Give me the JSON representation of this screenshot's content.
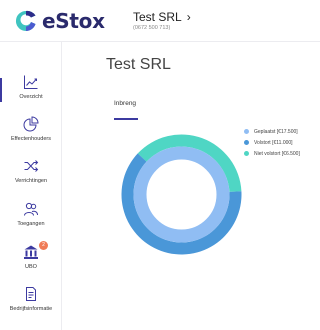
{
  "header": {
    "brand": "eStox",
    "company_name": "Test SRL",
    "company_id": "(0672 500 713)",
    "chevron": "›"
  },
  "sidebar": {
    "items": [
      {
        "label": "Overzicht",
        "icon": "line-chart-icon",
        "active": true
      },
      {
        "label": "Effectenhouders",
        "icon": "pie-chart-icon"
      },
      {
        "label": "Verrichtingen",
        "icon": "shuffle-icon"
      },
      {
        "label": "Toegangen",
        "icon": "users-icon"
      },
      {
        "label": "UBO",
        "icon": "bank-icon",
        "badge": "2"
      },
      {
        "label": "Bedrijfsinformatie",
        "icon": "document-icon"
      }
    ]
  },
  "main": {
    "title": "Test SRL",
    "card_title": "Inbreng"
  },
  "chart_data": {
    "type": "pie",
    "categories": [
      "Geplaatst",
      "Volstort",
      "Niet volstort"
    ],
    "legend": [
      {
        "label": "Geplaatst [€17.500]",
        "value": 17500,
        "color": "#90bdf3"
      },
      {
        "label": "Volstort [€11.000]",
        "value": 11000,
        "color": "#4a97d8"
      },
      {
        "label": "Niet volstort [€6.500]",
        "value": 6500,
        "color": "#4fd6c4"
      }
    ],
    "legend_position": "right"
  },
  "colors": {
    "accent": "#3c3aa0",
    "brand_text": "#2a2a6c",
    "badge": "#f07b56"
  }
}
